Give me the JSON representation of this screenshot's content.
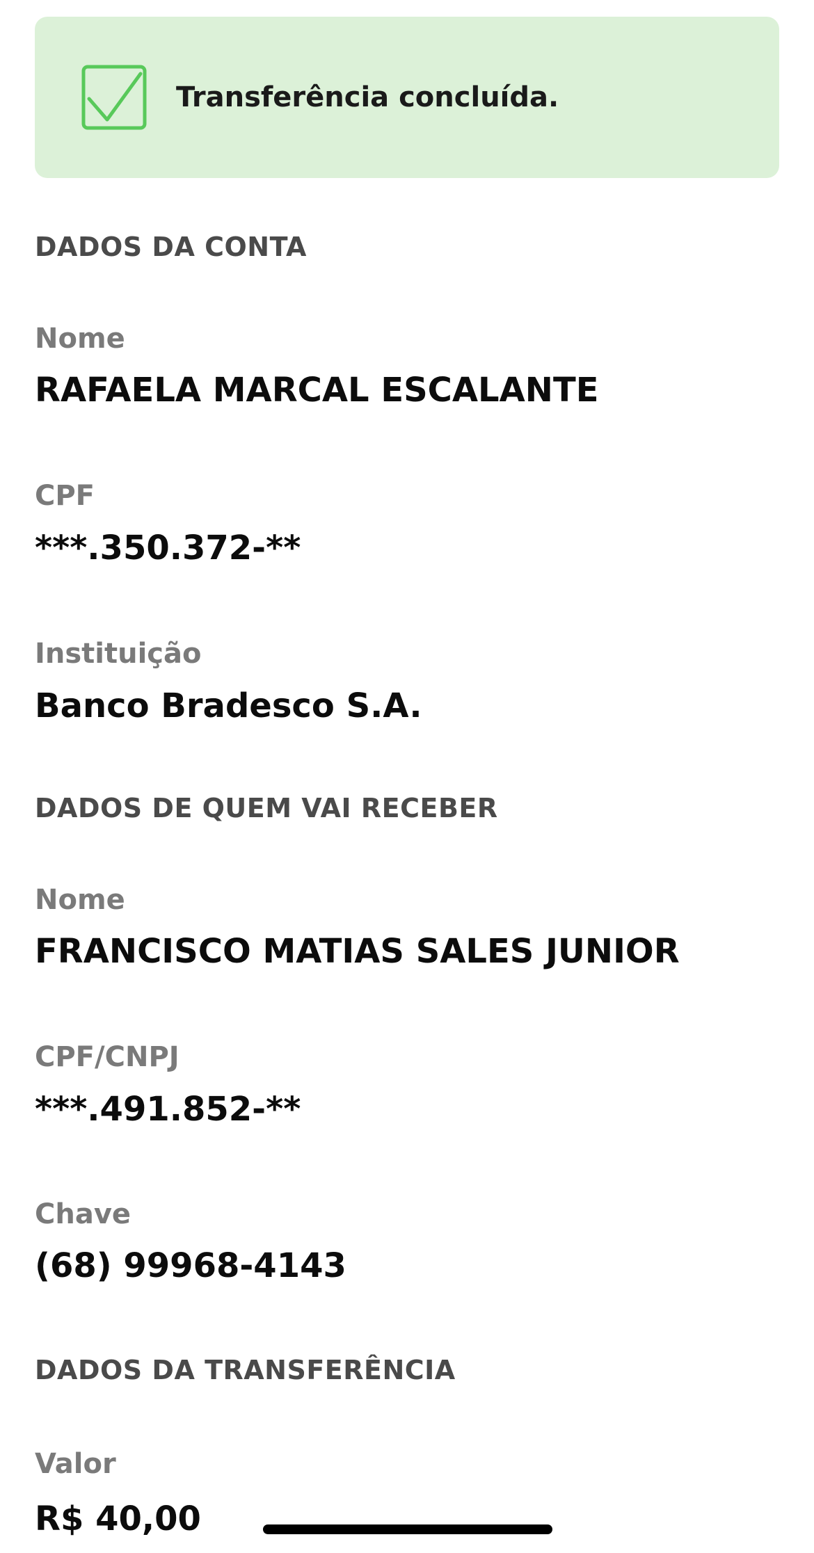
{
  "banner": {
    "message": "Transferência concluída.",
    "icon": "check-square-icon",
    "background_color": "#dcf1d8",
    "icon_color": "#58c95a"
  },
  "account_section": {
    "header": "DADOS DA CONTA",
    "name_label": "Nome",
    "name_value": "RAFAELA MARCAL ESCALANTE",
    "cpf_label": "CPF",
    "cpf_value": "***.350.372-**",
    "institution_label": "Instituição",
    "institution_value": "Banco Bradesco S.A."
  },
  "recipient_section": {
    "header": "DADOS DE QUEM VAI RECEBER",
    "name_label": "Nome",
    "name_value": "FRANCISCO MATIAS SALES JUNIOR",
    "document_label": "CPF/CNPJ",
    "document_value": "***.491.852-**",
    "key_label": "Chave",
    "key_value": "(68) 99968-4143"
  },
  "transfer_section": {
    "header": "DADOS DA TRANSFERÊNCIA",
    "amount_label": "Valor",
    "amount_value": "R$ 40,00"
  }
}
